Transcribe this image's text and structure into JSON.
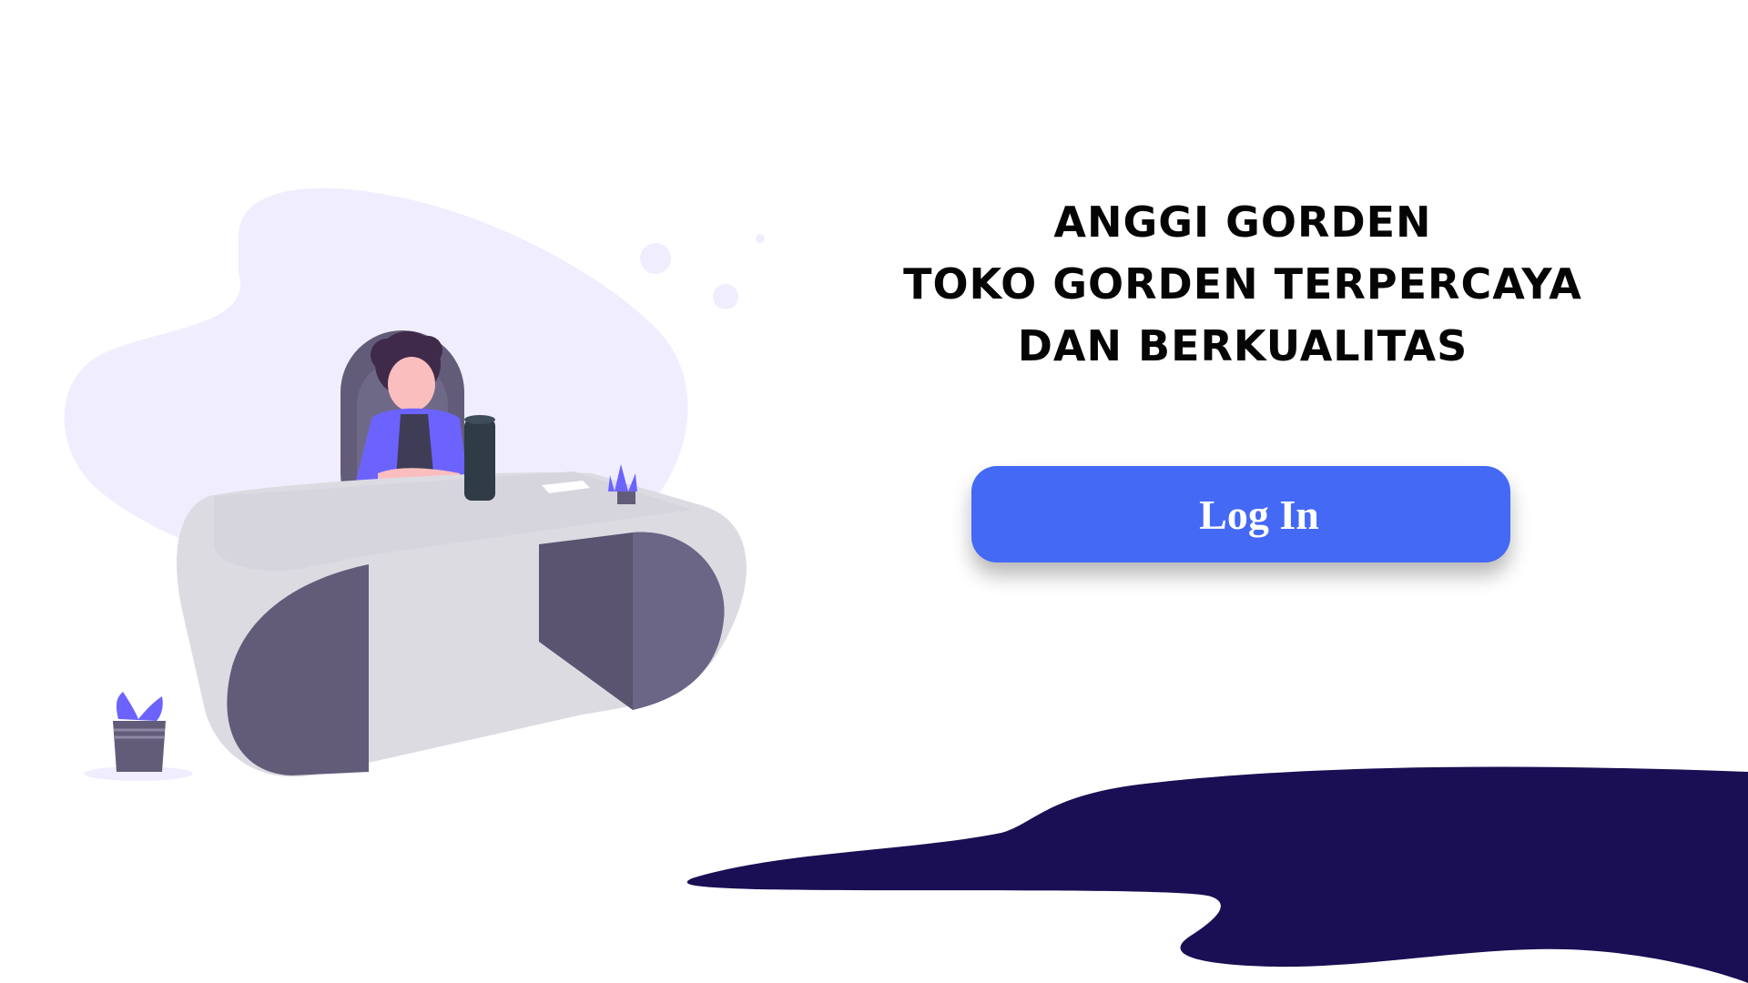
{
  "headline": {
    "line1": "ANGGI GORDEN",
    "line2": "TOKO GORDEN TERPERCAYA",
    "line3": "DAN BERKUALITAS"
  },
  "login_button": {
    "label": "Log In"
  },
  "illustration": {
    "subject": "person-at-desk-illustration"
  },
  "colors": {
    "accent": "#4469f5",
    "wave": "#1a0e54",
    "blob": "#f0eefe",
    "desk": "#dcdbe2",
    "desk_dark": "#625c79",
    "shirt": "#6c63ff"
  }
}
